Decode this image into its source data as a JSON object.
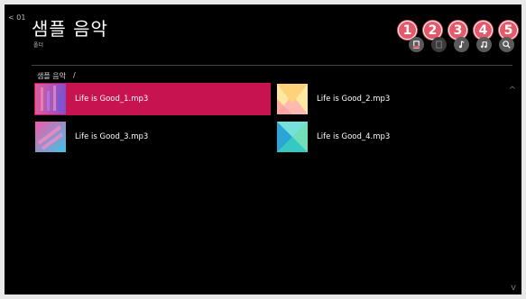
{
  "header": {
    "back_label": "< 01",
    "title": "샘플 음악",
    "subtitle": "폴더"
  },
  "badges": [
    "1",
    "2",
    "3",
    "4",
    "5"
  ],
  "toolbar": [
    {
      "icon": "delete-icon",
      "state": "enabled"
    },
    {
      "icon": "document-icon",
      "state": "disabled"
    },
    {
      "icon": "music-note-icon",
      "state": "enabled"
    },
    {
      "icon": "playlist-icon",
      "state": "enabled"
    },
    {
      "icon": "search-icon",
      "state": "enabled"
    }
  ],
  "breadcrumb": {
    "folder": "샘플 음악",
    "separator": "/"
  },
  "files": [
    {
      "name": "Life is Good_1.mp3",
      "selected": true
    },
    {
      "name": "Life is Good_2.mp3",
      "selected": false
    },
    {
      "name": "Life is Good_3.mp3",
      "selected": false
    },
    {
      "name": "Life is Good_4.mp3",
      "selected": false
    }
  ],
  "scroll": {
    "up": "^",
    "down": "v"
  },
  "colors": {
    "selection": "#c7134f",
    "badge": "#e35b6a",
    "background": "#000000"
  }
}
